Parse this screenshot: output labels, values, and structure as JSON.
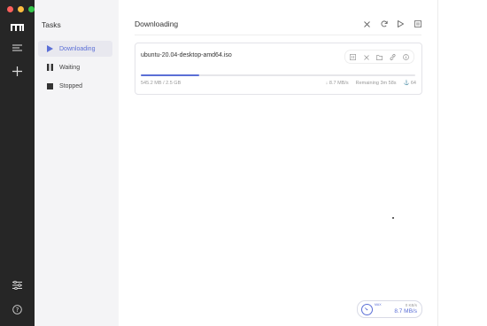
{
  "sidebar": {
    "traffic_colors": [
      "#fc605c",
      "#fdbc40",
      "#34c84a"
    ],
    "items": [
      "logo-icon",
      "menu-icon",
      "add-icon",
      "settings-sliders-icon",
      "help-icon"
    ]
  },
  "panel": {
    "title": "Tasks",
    "items": [
      {
        "label": "Downloading",
        "icon": "play-icon",
        "active": true
      },
      {
        "label": "Waiting",
        "icon": "pause-icon",
        "active": false
      },
      {
        "label": "Stopped",
        "icon": "stop-icon",
        "active": false
      }
    ]
  },
  "main": {
    "title": "Downloading",
    "header_actions": [
      "close-icon",
      "refresh-icon",
      "play-icon",
      "pause-icon"
    ]
  },
  "task": {
    "filename": "ubuntu-20.04-desktop-amd64.iso",
    "actions": [
      "pause-icon",
      "close-icon",
      "folder-icon",
      "link-icon",
      "info-icon"
    ],
    "progress_fraction": 0.214,
    "size_text": "545.2 MB / 2.5 GB",
    "speed": "↓ 8.7 MB/s",
    "remaining": "Remaining 3m 58s",
    "connections": "⚓ 64"
  },
  "speedometer": {
    "label": "MAX",
    "upload": "0 KB/s",
    "download": "8.7 MB/s"
  },
  "colors": {
    "accent": "#5b6fd6",
    "sidebar_bg": "#262626",
    "panel_bg": "#f4f4f6"
  }
}
